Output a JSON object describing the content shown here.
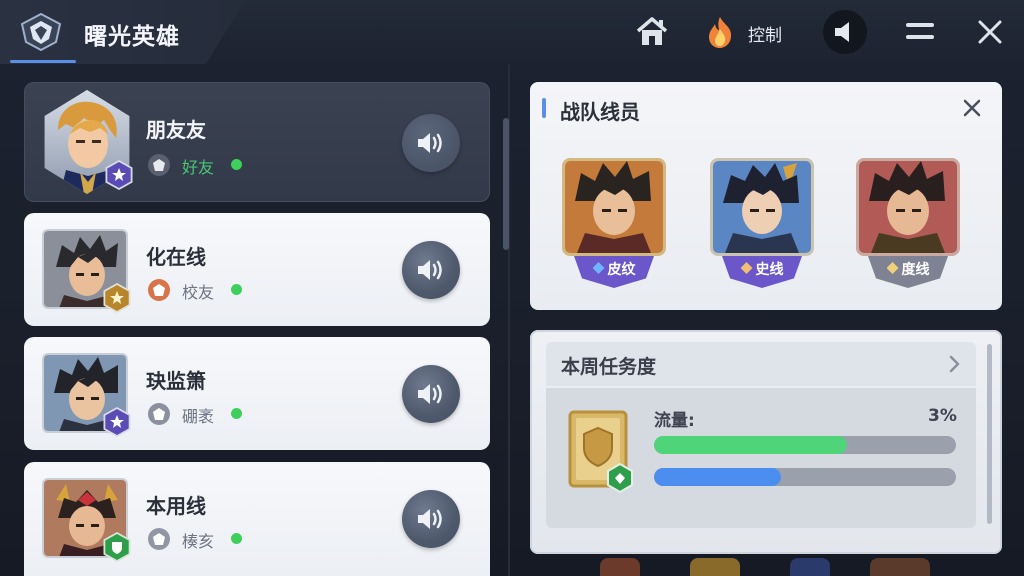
{
  "header": {
    "title": "曙光英雄",
    "nav_label": "控制",
    "icons": [
      "app-logo-icon",
      "home-icon",
      "flame-icon",
      "mute-speaker-icon",
      "menu-icon",
      "close-icon"
    ]
  },
  "friends": [
    {
      "name": "朋友友",
      "status": "好友",
      "online": true,
      "selected": true,
      "badge_color": "#5a4bb5",
      "rank_color": "#5b6070"
    },
    {
      "name": "化在线",
      "status": "校友",
      "online": true,
      "selected": false,
      "badge_color": "#b8862a",
      "rank_color": "#d9744a"
    },
    {
      "name": "玦监箫",
      "status": "硼袤",
      "online": true,
      "selected": false,
      "badge_color": "#5a4bb5",
      "rank_color": "#8a90a0"
    },
    {
      "name": "本用线",
      "status": "楱亥",
      "online": true,
      "selected": false,
      "badge_color": "#2f9e4a",
      "rank_color": "#9096a4"
    }
  ],
  "team": {
    "title": "战队线员",
    "members": [
      {
        "tag": "皮纹",
        "tag_color": "#6b57c9",
        "gem_color": "#6fb4ff",
        "frame": "#d2b981"
      },
      {
        "tag": "史线",
        "tag_color": "#6b57c9",
        "gem_color": "#f0c070",
        "frame": "#c9c3b0"
      },
      {
        "tag": "度线",
        "tag_color": "#7e8292",
        "gem_color": "#f2d07a",
        "frame": "#c9a9a0"
      }
    ]
  },
  "weekly_task": {
    "title": "本周任务度",
    "progress_label": "流量:",
    "progress_percent": "3%",
    "bars": [
      {
        "name": "green-progress-bar",
        "fraction": 0.64,
        "color": "#4fd47a"
      },
      {
        "name": "blue-progress-bar",
        "fraction": 0.42,
        "color": "#4c8ef0"
      }
    ]
  },
  "colors": {
    "accent": "#5a8fe8",
    "online": "#3fcf5d",
    "background": "#1c2230"
  }
}
